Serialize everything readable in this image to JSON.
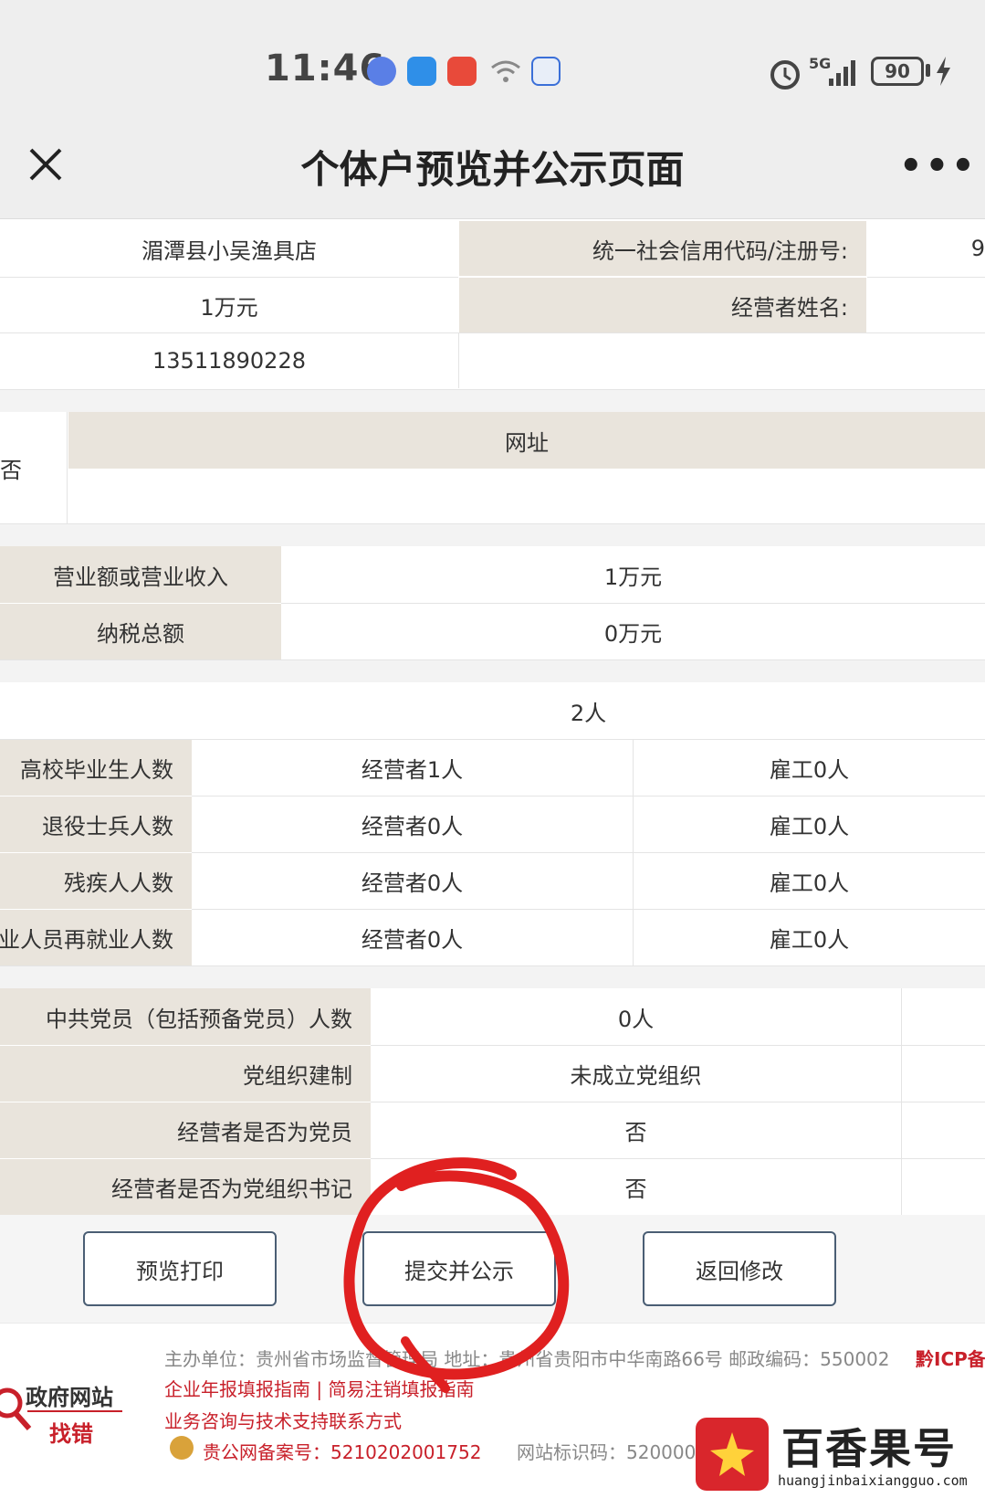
{
  "status_bar": {
    "time": "11:46",
    "network": "5G",
    "battery": "90"
  },
  "nav": {
    "title": "个体户预览并公示页面"
  },
  "basic_info": {
    "name_value": "湄潭县小吴渔具店",
    "credit_code_label": "统一社会信用代码/注册号:",
    "credit_code_value_partial": "9",
    "capital_value": "1万元",
    "operator_label": "经营者姓名:",
    "phone_value": "13511890228"
  },
  "website_section": {
    "left_partial": "否",
    "header": "网址"
  },
  "finance": {
    "rows": [
      {
        "label": "营业额或营业收入",
        "value": "1万元"
      },
      {
        "label": "纳税总额",
        "value": "0万元"
      }
    ]
  },
  "employment": {
    "total_value": "2人",
    "rows": [
      {
        "label": "高校毕业生人数",
        "operator": "经营者1人",
        "employee": "雇工0人"
      },
      {
        "label": "退役士兵人数",
        "operator": "经营者0人",
        "employee": "雇工0人"
      },
      {
        "label": "残疾人人数",
        "operator": "经营者0人",
        "employee": "雇工0人"
      },
      {
        "label": "业人员再就业人数",
        "operator": "经营者0人",
        "employee": "雇工0人"
      }
    ]
  },
  "party": {
    "rows": [
      {
        "label": "中共党员（包括预备党员）人数",
        "value": "0人"
      },
      {
        "label": "党组织建制",
        "value": "未成立党组织"
      },
      {
        "label": "经营者是否为党员",
        "value": "否"
      },
      {
        "label": "经营者是否为党组织书记",
        "value": "否"
      }
    ]
  },
  "buttons": {
    "preview_print": "预览打印",
    "submit_publish": "提交并公示",
    "return_edit": "返回修改"
  },
  "footer": {
    "logo_line1": "政府网站",
    "logo_line2": "找错",
    "host": "主办单位：贵州省市场监督管理局 地址：贵州省贵阳市中华南路66号 邮政编码：550002",
    "icp": "黔ICP备",
    "links": "企业年报填报指南 | 简易注销填报指南",
    "support": "业务咨询与技术支持联系方式",
    "police_record": "贵公网备案号：5210202001752",
    "site_code": "网站标识码：520000",
    "watermark_text": "百香果号",
    "watermark_url": "huangjinbaixiangguo.com"
  },
  "colors": {
    "label_bg": "#e9e4dc",
    "button_border": "#4a5e74",
    "annotation_circle": "#e02020",
    "footer_red": "#c8202a"
  }
}
